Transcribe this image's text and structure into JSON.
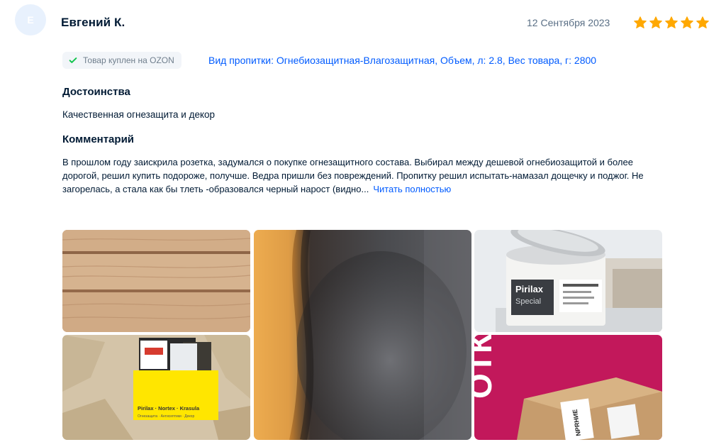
{
  "review": {
    "avatar_letter": "Е",
    "author": "Евгений К.",
    "date": "12 Сентября 2023",
    "rating": 5,
    "rating_max": 5,
    "verified_label": "Товар куплен на OZON",
    "variant": "Вид пропитки: Огнебиозащитная-Влагозащитная, Объем, л: 2.8, Вес товара, г: 2800",
    "advantages_title": "Достоинства",
    "advantages_text": "Качественная огнезащита и декор",
    "comment_title": "Комментарий",
    "comment_text": "В прошлом году заискрила розетка, задумался о покупке огнезащитного состава. Выбирал между дешевой огнебиозащитой и более дорогой, решил купить подороже, получше. Ведра пришли без повреждений. Пропитку решил испытать-намазал дощечку и поджог. Не загорелась, а стала как бы тлеть -образовался черный нарост (видно...",
    "read_more": "Читать полностью"
  },
  "photos": {
    "photo1": {
      "subject": "wood-planks"
    },
    "photo2": {
      "subject": "charred-surface"
    },
    "photo3": {
      "subject": "paint-can",
      "brand_line1": "Pirilax",
      "brand_line2": "Special"
    },
    "photo4": {
      "subject": "product-box",
      "box_text": "Pirilax · Nortex · Krasula",
      "box_subtext": "Огнезащита · Антисептики · Декор"
    },
    "photo5": {
      "subject": "parcel-box",
      "bg_letters": "ОТК",
      "label_text": "NPRНИЕ"
    }
  },
  "colors": {
    "accent": "#005bff",
    "star": "#ffa800",
    "check": "#10c44c"
  }
}
